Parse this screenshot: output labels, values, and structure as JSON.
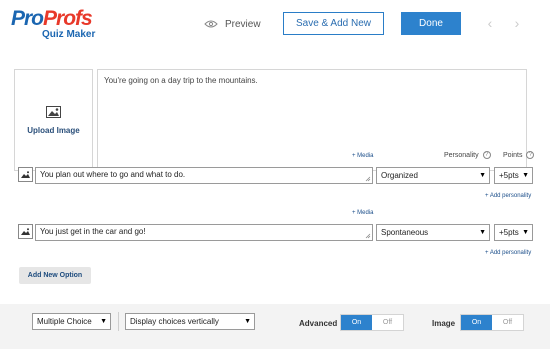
{
  "header": {
    "logo_part1": "Pro",
    "logo_part2": "Profs",
    "logo_sub": "Quiz Maker",
    "preview_label": "Preview",
    "save_add_label": "Save & Add New",
    "done_label": "Done",
    "prev_arrow": "‹",
    "next_arrow": "›"
  },
  "question": {
    "upload_label": "Upload Image",
    "text": "You're going on a day trip to the mountains."
  },
  "columns": {
    "personality": "Personality",
    "points": "Points",
    "help": "?"
  },
  "options": [
    {
      "media_link": "+ Media",
      "text": "You plan out where to go and what to do.",
      "personality": "Organized",
      "points": "+5pts",
      "add_personality": "+ Add personality"
    },
    {
      "media_link": "+ Media",
      "text": "You just get in the car and go!",
      "personality": "Spontaneous",
      "points": "+5pts",
      "add_personality": "+ Add personality"
    }
  ],
  "add_option_label": "Add New Option",
  "footer": {
    "question_type": "Multiple Choice",
    "display_mode": "Display choices vertically",
    "advanced_label": "Advanced",
    "advanced_on": "On",
    "advanced_off": "Off",
    "image_label": "Image",
    "image_on": "On",
    "image_off": "Off"
  },
  "colors": {
    "brand_blue": "#1b66b1",
    "brand_red": "#e8392a",
    "accent": "#2d82cd"
  }
}
